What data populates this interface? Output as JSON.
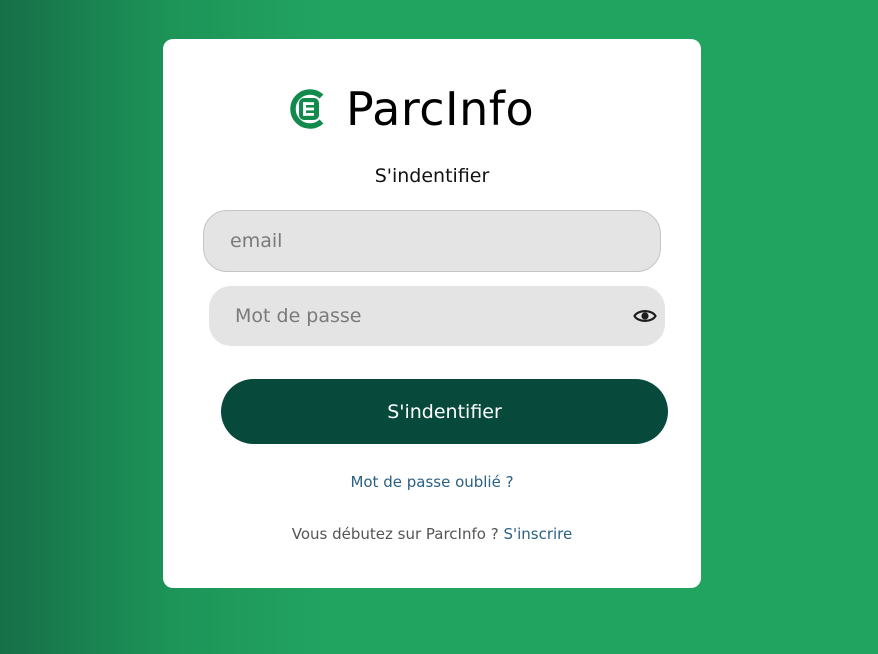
{
  "brand": {
    "name": "ParcInfo",
    "icon": "brand-e-circle-icon",
    "color": "#128a4c"
  },
  "login": {
    "title": "S'indentifier",
    "email_placeholder": "email",
    "password_placeholder": "Mot de passe",
    "submit_label": "S'indentifier",
    "forgot_label": "Mot de passe oublié ?",
    "signup_prompt": "Vous débutez sur ParcInfo ?",
    "signup_label": "S'inscrire"
  },
  "colors": {
    "button": "#074a3c",
    "link": "#2b6185",
    "background_start": "#166f48",
    "background_end": "#22a461"
  }
}
